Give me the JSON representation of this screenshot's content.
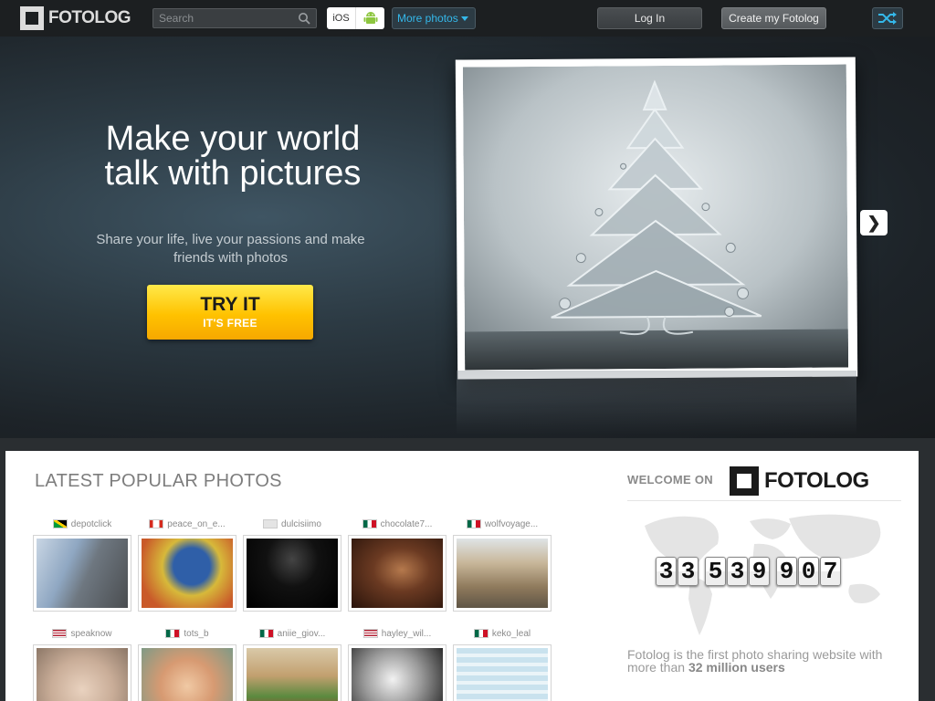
{
  "nav": {
    "logo_text": "FOTOLOG",
    "search_placeholder": "Search",
    "ios_label": "iOS",
    "more_photos_label": "More photos",
    "login_label": "Log In",
    "create_label": "Create my Fotolog",
    "accent_color": "#34b8ea"
  },
  "hero": {
    "title_line1": "Make your world",
    "title_line2": "talk with pictures",
    "subtitle_line1": "Share your life, live your passions and make",
    "subtitle_line2": "friends with photos",
    "cta_main": "TRY IT",
    "cta_sub": "IT'S FREE",
    "next_label": "❯"
  },
  "latest": {
    "title": "LATEST POPULAR PHOTOS",
    "photos": [
      {
        "user": "depotclick",
        "flag": "jamaica"
      },
      {
        "user": "peace_on_e...",
        "flag": "canada"
      },
      {
        "user": "dulcisiimo",
        "flag": "generic"
      },
      {
        "user": "chocolate7...",
        "flag": "mexico"
      },
      {
        "user": "wolfvoyage...",
        "flag": "mexico"
      },
      {
        "user": "speaknow",
        "flag": "usa"
      },
      {
        "user": "tots_b",
        "flag": "mexico"
      },
      {
        "user": "aniie_giov...",
        "flag": "mexico"
      },
      {
        "user": "hayley_wil...",
        "flag": "usa"
      },
      {
        "user": "keko_leal",
        "flag": "mexico"
      }
    ]
  },
  "welcome": {
    "label": "WELCOME ON",
    "brand": "FOTOLOG",
    "counter_digits": [
      "3",
      "3",
      "5",
      "3",
      "9",
      "9",
      "0",
      "7"
    ],
    "tagline_pre": "Fotolog is the first photo sharing website with more than ",
    "tagline_bold": "32 million users"
  }
}
